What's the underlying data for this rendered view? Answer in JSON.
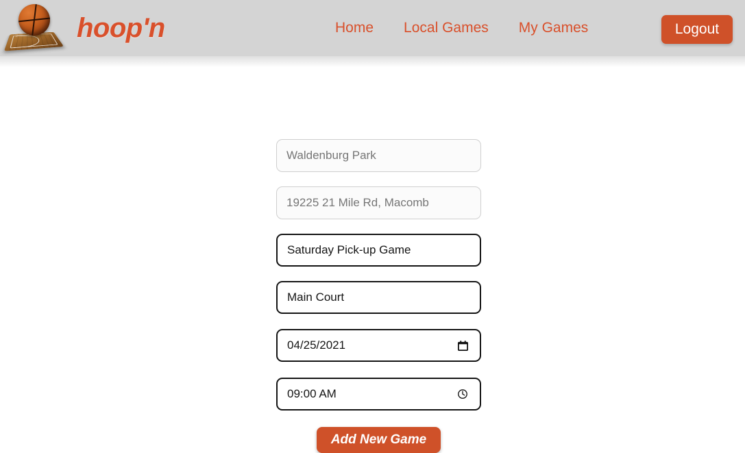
{
  "header": {
    "brand_name": "hoop'n",
    "logo_icon": "basketball-court-logo",
    "nav": [
      {
        "label": "Home",
        "name": "nav-link-home"
      },
      {
        "label": "Local Games",
        "name": "nav-link-local-games"
      },
      {
        "label": "My Games",
        "name": "nav-link-my-games"
      }
    ],
    "logout_label": "Logout",
    "background_color": "#d4d4d4",
    "accent_color": "#d9502b",
    "button_color": "#cf5129"
  },
  "form": {
    "park_name": {
      "placeholder": "Waldenburg Park",
      "value": "",
      "state": "placeholder"
    },
    "park_address": {
      "placeholder": "19225 21 Mile Rd, Macomb",
      "value": "",
      "state": "placeholder"
    },
    "game_name": {
      "placeholder": "",
      "value": "Saturday Pick-up Game",
      "state": "filled"
    },
    "court_name": {
      "placeholder": "",
      "value": "Main Court",
      "state": "filled"
    },
    "game_date": {
      "value": "04/25/2021",
      "icon": "calendar-icon",
      "state": "filled"
    },
    "game_time": {
      "value": "09:00 AM",
      "icon": "clock-icon",
      "state": "filled"
    },
    "submit_label": "Add New Game"
  }
}
